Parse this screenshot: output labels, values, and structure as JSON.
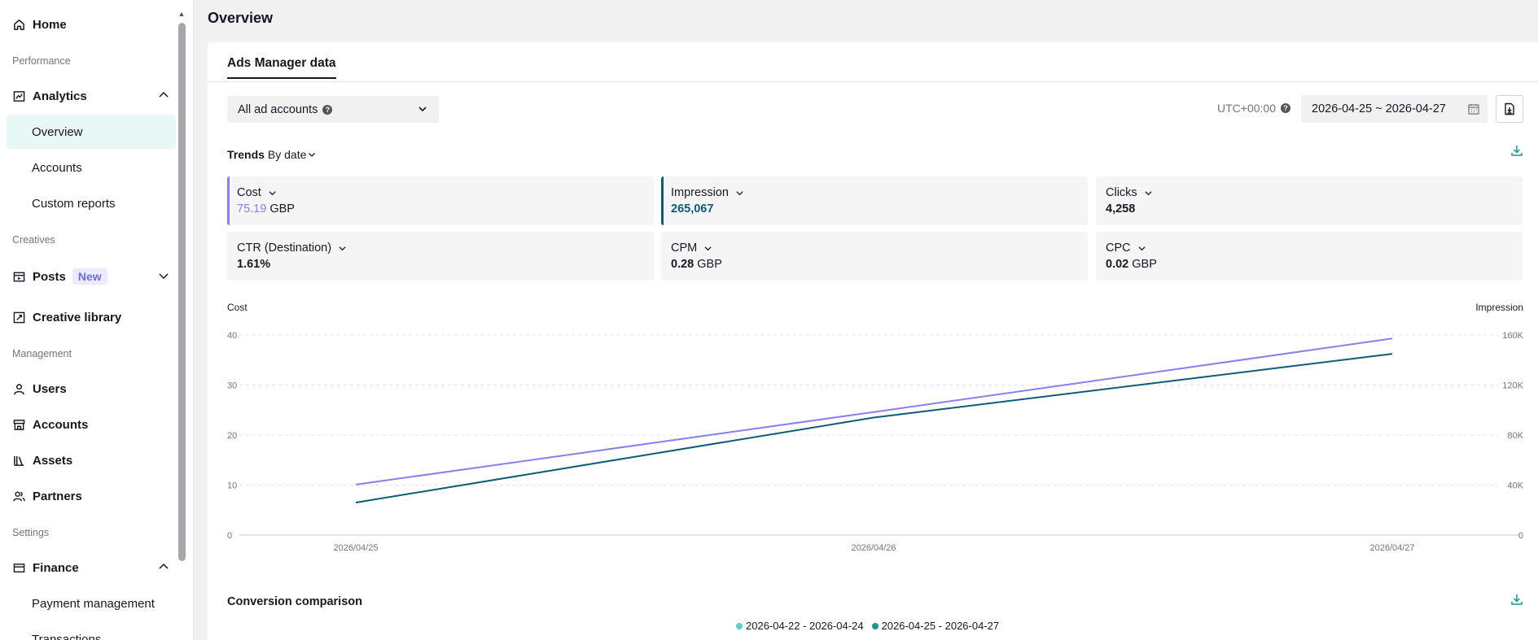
{
  "sidebar": {
    "home": "Home",
    "sections": {
      "performance": "Performance",
      "creatives": "Creatives",
      "management": "Management",
      "settings": "Settings"
    },
    "analytics": "Analytics",
    "analytics_sub": [
      "Overview",
      "Accounts",
      "Custom reports"
    ],
    "posts": "Posts",
    "posts_badge": "New",
    "creative_library": "Creative library",
    "users": "Users",
    "accounts": "Accounts",
    "assets": "Assets",
    "partners": "Partners",
    "finance": "Finance",
    "finance_sub": [
      "Payment management",
      "Transactions"
    ]
  },
  "header": {
    "title": "Overview"
  },
  "tabs": {
    "active": "Ads Manager data"
  },
  "filters": {
    "account_select": "All ad accounts",
    "timezone": "UTC+00:00",
    "date_range": "2026-04-25 ~ 2026-04-27"
  },
  "trends": {
    "title": "Trends",
    "by": "By date"
  },
  "metrics": [
    {
      "label": "Cost",
      "value": "75.19",
      "unit": "GBP",
      "color": "#8a7ff0"
    },
    {
      "label": "Impression",
      "value": "265,067",
      "unit": "",
      "color": "#0b5d77"
    },
    {
      "label": "Clicks",
      "value": "4,258",
      "unit": ""
    },
    {
      "label": "CTR (Destination)",
      "value": "1.61%",
      "unit": ""
    },
    {
      "label": "CPM",
      "value": "0.28",
      "unit": "GBP"
    },
    {
      "label": "CPC",
      "value": "0.02",
      "unit": "GBP"
    }
  ],
  "chart_data": {
    "type": "line",
    "x": [
      "2026/04/25",
      "2026/04/26",
      "2026/04/27"
    ],
    "y_left_label": "Cost",
    "y_right_label": "Impression",
    "y_left_ticks": [
      "0",
      "10",
      "20",
      "30",
      "40"
    ],
    "y_right_ticks": [
      "0",
      "40K",
      "80K",
      "120K",
      "160K"
    ],
    "y_left_range": [
      0,
      40
    ],
    "y_right_range": [
      0,
      160000
    ],
    "grid": true,
    "series": [
      {
        "name": "Cost",
        "axis": "left",
        "color": "#8a7ff0",
        "values": [
          10.1,
          24.6,
          39.3
        ]
      },
      {
        "name": "Impression",
        "axis": "right",
        "color": "#0b5d77",
        "values": [
          26000,
          94000,
          145000
        ]
      }
    ]
  },
  "conversion": {
    "title": "Conversion comparison",
    "legend": [
      {
        "label": "2026-04-22 - 2026-04-24",
        "color": "#5fd0c8"
      },
      {
        "label": "2026-04-25 - 2026-04-27",
        "color": "#119a93"
      }
    ]
  }
}
